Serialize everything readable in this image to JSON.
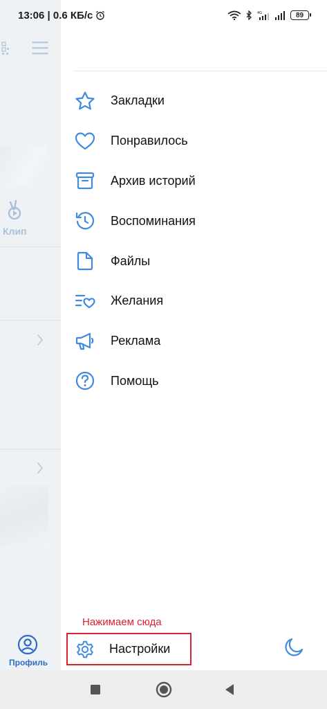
{
  "status_bar": {
    "time_speed": "13:06 | 0.6 КБ/с",
    "battery": "89"
  },
  "background": {
    "clip_label": "Клип",
    "profile_label": "Профиль"
  },
  "menu": {
    "items": [
      {
        "label": "Закладки",
        "icon": "star-icon"
      },
      {
        "label": "Понравилось",
        "icon": "heart-icon"
      },
      {
        "label": "Архив историй",
        "icon": "archive-icon"
      },
      {
        "label": "Воспоминания",
        "icon": "history-icon"
      },
      {
        "label": "Файлы",
        "icon": "file-icon"
      },
      {
        "label": "Желания",
        "icon": "wishlist-icon"
      },
      {
        "label": "Реклама",
        "icon": "megaphone-icon"
      },
      {
        "label": "Помощь",
        "icon": "help-icon"
      }
    ],
    "settings_label": "Настройки"
  },
  "annotation": "Нажимаем сюда",
  "colors": {
    "accent": "#2a6ec4",
    "icon_blue": "#3f8ae0",
    "highlight": "#d8232f"
  }
}
